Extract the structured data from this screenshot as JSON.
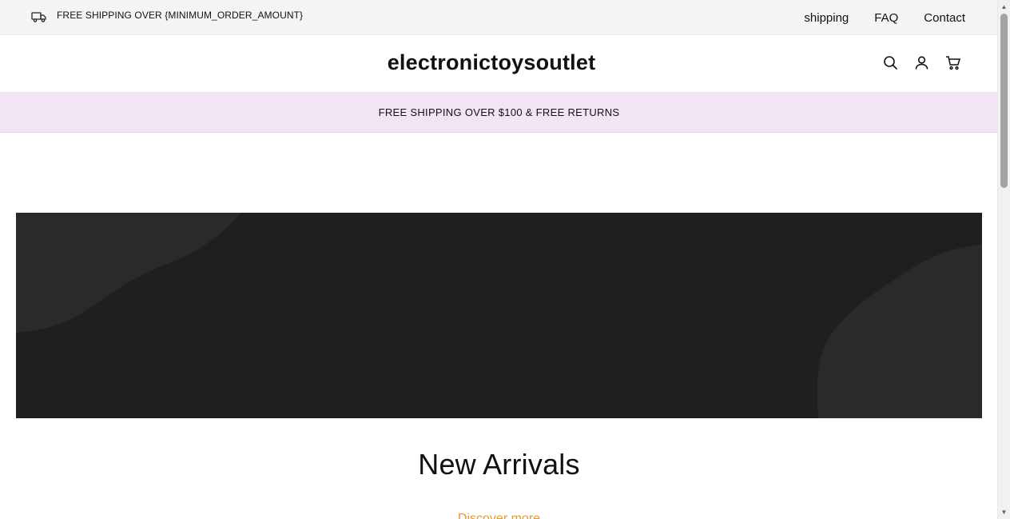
{
  "topbar": {
    "shipping_notice": "FREE SHIPPING OVER {MINIMUM_ORDER_AMOUNT}",
    "nav": [
      {
        "label": "shipping"
      },
      {
        "label": "FAQ"
      },
      {
        "label": "Contact"
      }
    ]
  },
  "header": {
    "logo": "electronictoysoutlet",
    "icons": [
      "search-icon",
      "account-icon",
      "cart-icon"
    ]
  },
  "promo": {
    "text": "FREE SHIPPING OVER $100 & FREE RETURNS"
  },
  "hero": {
    "background_color": "#1f1f1f",
    "shape_color": "#2a2a2a"
  },
  "section": {
    "title": "New Arrivals",
    "link": "Discover more",
    "link_color": "#e59a2f"
  }
}
